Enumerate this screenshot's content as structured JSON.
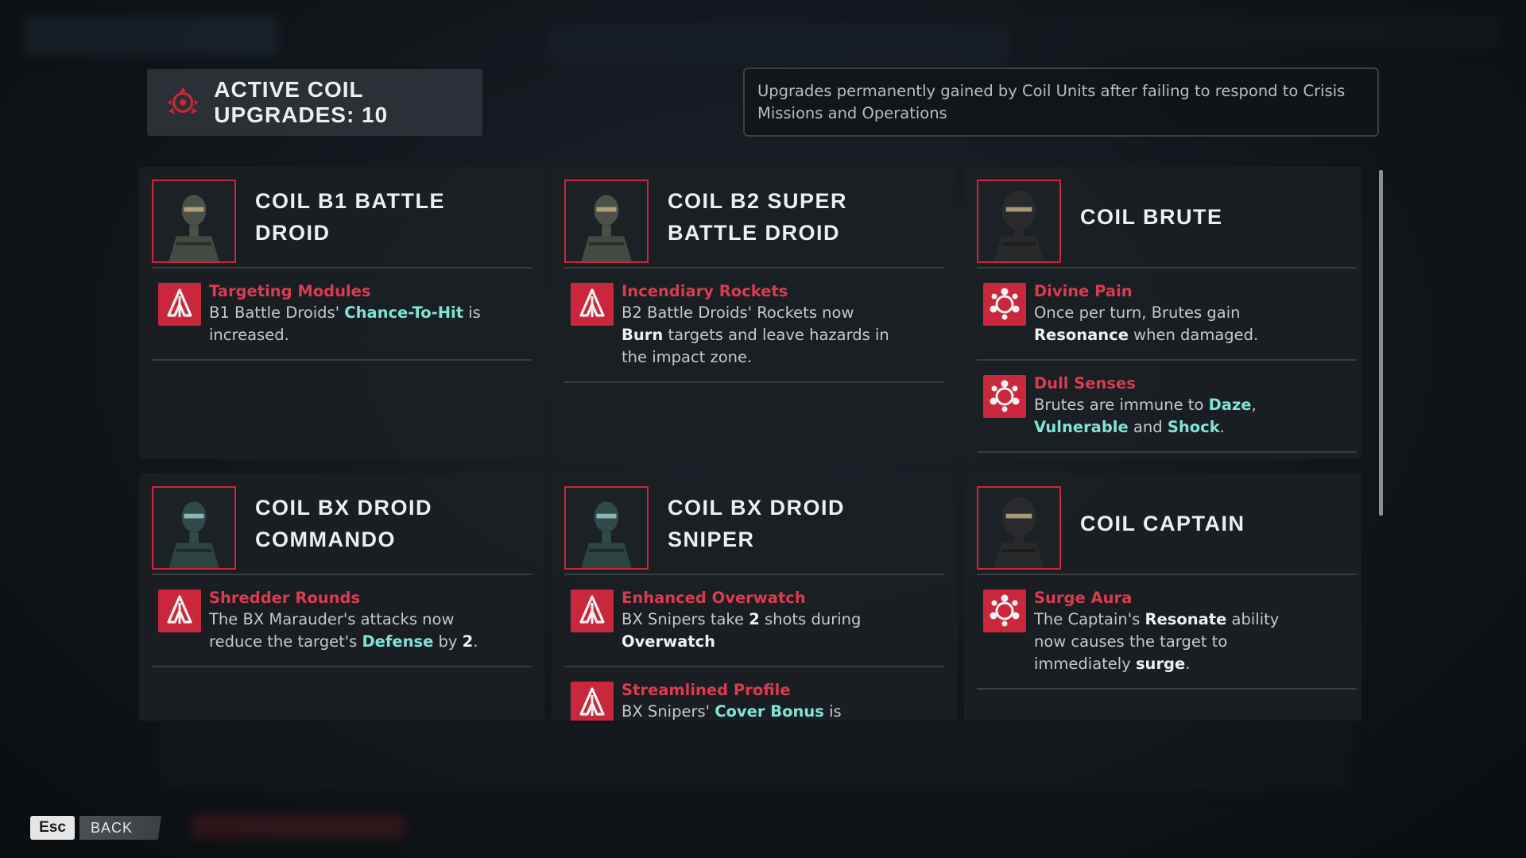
{
  "header": {
    "active_upgrades_title": "ACTIVE COIL UPGRADES: 10",
    "description": "Upgrades permanently gained by Coil Units after failing to respond to Crisis Missions and Operations"
  },
  "units": [
    {
      "name": "COIL B1 BATTLE DROID",
      "portrait_icon": "b1-battle-droid-portrait",
      "upgrades": [
        {
          "icon": "rocket-chevron-icon",
          "name": "Targeting Modules",
          "desc": [
            [
              "B1 Battle Droids' ",
              ""
            ],
            [
              "Chance-To-Hit",
              "c"
            ],
            [
              " is increased.",
              ""
            ]
          ]
        }
      ]
    },
    {
      "name": "COIL B2 SUPER BATTLE DROID",
      "portrait_icon": "b2-super-battle-droid-portrait",
      "upgrades": [
        {
          "icon": "rocket-chevron-icon",
          "name": "Incendiary Rockets",
          "desc": [
            [
              "B2 Battle Droids' Rockets now ",
              ""
            ],
            [
              "Burn",
              "w"
            ],
            [
              " targets and leave hazards in the impact zone.",
              ""
            ]
          ]
        }
      ]
    },
    {
      "name": "COIL BRUTE",
      "portrait_icon": "brute-portrait",
      "upgrades": [
        {
          "icon": "resonance-icon",
          "name": "Divine Pain",
          "desc": [
            [
              "Once per turn, Brutes gain ",
              ""
            ],
            [
              "Resonance",
              "w"
            ],
            [
              " when damaged.",
              ""
            ]
          ]
        },
        {
          "icon": "resonance-icon",
          "name": "Dull Senses",
          "desc": [
            [
              "Brutes are immune to ",
              ""
            ],
            [
              "Daze",
              "c"
            ],
            [
              ", ",
              ""
            ],
            [
              "Vulnerable",
              "c"
            ],
            [
              " and ",
              ""
            ],
            [
              "Shock",
              "c"
            ],
            [
              ".",
              ""
            ]
          ]
        }
      ]
    },
    {
      "name": "COIL BX DROID COMMANDO",
      "portrait_icon": "bx-droid-commando-portrait",
      "upgrades": [
        {
          "icon": "rocket-chevron-icon",
          "name": "Shredder Rounds",
          "desc": [
            [
              "The BX Marauder's attacks now reduce the target's ",
              ""
            ],
            [
              "Defense",
              "c"
            ],
            [
              " by ",
              ""
            ],
            [
              "2",
              "w"
            ],
            [
              ".",
              ""
            ]
          ]
        }
      ]
    },
    {
      "name": "COIL BX DROID SNIPER",
      "portrait_icon": "bx-droid-sniper-portrait",
      "upgrades": [
        {
          "icon": "rocket-chevron-icon",
          "name": "Enhanced Overwatch",
          "desc": [
            [
              "BX Snipers take ",
              ""
            ],
            [
              "2",
              "w"
            ],
            [
              " shots during ",
              ""
            ],
            [
              "Overwatch",
              "w"
            ]
          ]
        },
        {
          "icon": "rocket-chevron-icon",
          "name": "Streamlined Profile",
          "desc": [
            [
              "BX Snipers' ",
              ""
            ],
            [
              "Cover Bonus",
              "c"
            ],
            [
              " is",
              ""
            ]
          ]
        }
      ]
    },
    {
      "name": "COIL CAPTAIN",
      "portrait_icon": "captain-portrait",
      "upgrades": [
        {
          "icon": "resonance-icon",
          "name": "Surge Aura",
          "desc": [
            [
              "The Captain's ",
              ""
            ],
            [
              "Resonate",
              "w"
            ],
            [
              " ability now causes the target to immediately ",
              ""
            ],
            [
              "surge",
              "w"
            ],
            [
              ".",
              ""
            ]
          ]
        }
      ]
    }
  ],
  "footer": {
    "esc_key": "Esc",
    "back_label": "BACK"
  },
  "colors": {
    "accent_red": "#c8273c",
    "upgrade_name": "#d93c50",
    "highlight_cyan": "#7fe4d4",
    "panel": "#1b1f24"
  }
}
